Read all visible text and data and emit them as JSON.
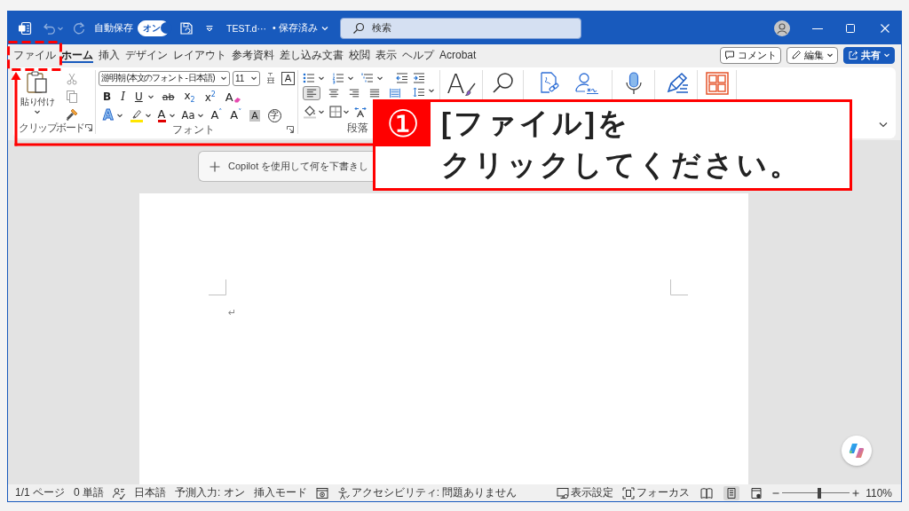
{
  "title_bar": {
    "quick_access": [
      {
        "kind": "undo",
        "disabled": true
      },
      {
        "kind": "redo",
        "disabled": true
      }
    ],
    "autosave": {
      "label": "自動保存",
      "on": true,
      "state_label": "オン"
    },
    "file_name": "TEST.d···",
    "save_status": "• 保存済み",
    "search": {
      "placeholder": "検索"
    }
  },
  "tabs": [
    {
      "label": "ファイル",
      "selected": false,
      "highlighted": true
    },
    {
      "label": "ホーム",
      "selected": true,
      "highlighted": false
    },
    {
      "label": "挿入",
      "selected": false,
      "highlighted": false
    },
    {
      "label": "デザイン",
      "selected": false,
      "highlighted": false
    },
    {
      "label": "レイアウト",
      "selected": false,
      "highlighted": false
    },
    {
      "label": "参考資料",
      "selected": false,
      "highlighted": false
    },
    {
      "label": "差し込み文書",
      "selected": false,
      "highlighted": false
    },
    {
      "label": "校閲",
      "selected": false,
      "highlighted": false
    },
    {
      "label": "表示",
      "selected": false,
      "highlighted": false
    },
    {
      "label": "ヘルプ",
      "selected": false,
      "highlighted": false
    },
    {
      "label": "Acrobat",
      "selected": false,
      "highlighted": false
    }
  ],
  "tab_actions": [
    {
      "kind": "comment",
      "label": "コメント"
    },
    {
      "kind": "edit",
      "label": "編集"
    },
    {
      "kind": "share",
      "label": "共有"
    }
  ],
  "ribbon": {
    "clipboard": {
      "paste_label": "貼り付け",
      "group_label": "クリップボード"
    },
    "font": {
      "font_name": "游明朝 (本文のフォント - 日本語)",
      "font_size": "11",
      "border_glyph": "A",
      "format_buttons": [
        {
          "kind": "bold",
          "text": "B",
          "dropdown": false
        },
        {
          "kind": "italic",
          "text": "I",
          "dropdown": false
        },
        {
          "kind": "underline",
          "text": "U",
          "dropdown": true
        },
        {
          "kind": "strike",
          "text": "ab",
          "dropdown": false
        },
        {
          "kind": "subscript",
          "text": "x$_{2}$",
          "dropdown": false
        },
        {
          "kind": "superscript",
          "text": "x$^{2}$",
          "dropdown": false
        },
        {
          "kind": "clear",
          "text": "A",
          "dropdown": false
        }
      ],
      "effect_buttons": [
        {
          "kind": "effect",
          "text": "A",
          "dropdown": true
        },
        {
          "kind": "highlight",
          "dropdown": true
        },
        {
          "kind": "color",
          "text": "A",
          "dropdown": true
        },
        {
          "kind": "case",
          "text": "Aa",
          "dropdown": true
        },
        {
          "kind": "grow",
          "text": "A$^{˄}$",
          "dropdown": false
        },
        {
          "kind": "shrink",
          "text": "A$^{˅}$",
          "dropdown": false
        },
        {
          "kind": "shade",
          "text": "A",
          "dropdown": false
        },
        {
          "kind": "enclose",
          "text": "字",
          "dropdown": false
        }
      ],
      "group_label": "フォント"
    },
    "paragraph": {
      "alignment": [
        {
          "kind": "left",
          "selected": true
        },
        {
          "kind": "center",
          "selected": false
        },
        {
          "kind": "right",
          "selected": false
        },
        {
          "kind": "justify",
          "selected": false
        },
        {
          "kind": "distributed",
          "selected": false
        }
      ],
      "group_label": "段落"
    },
    "styles": {
      "glyph": "A"
    }
  },
  "document": {
    "copilot_prompt": {
      "placeholder": "Copilot を使用して何を下書きし"
    },
    "paragraph_mark": "↵"
  },
  "status_bar": {
    "items": [
      {
        "kind": "text",
        "text": "1/1 ページ"
      },
      {
        "kind": "text",
        "text": "0 単語"
      },
      {
        "kind": "proofing"
      },
      {
        "kind": "text",
        "text": "日本語"
      },
      {
        "kind": "text",
        "text": "予測入力: オン"
      },
      {
        "kind": "text",
        "text": "挿入モード"
      },
      {
        "kind": "macro"
      },
      {
        "kind": "accessibility",
        "text": "アクセシビリティ: 問題ありません"
      }
    ],
    "display_settings": "表示設定",
    "focus": "フォーカス",
    "layouts": [
      {
        "kind": "read",
        "selected": false
      },
      {
        "kind": "print",
        "selected": true
      },
      {
        "kind": "web",
        "selected": false
      }
    ],
    "zoom": {
      "level": 0.55,
      "reading": "110%"
    }
  },
  "annotation": {
    "step": "①",
    "lines": [
      "[ファイル]を",
      "クリックしてください。"
    ]
  }
}
